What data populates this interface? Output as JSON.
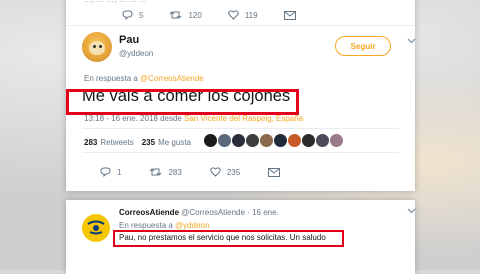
{
  "previous_tweet": {
    "faded_text": "...,  ... ..., ...  ... ...",
    "reply_count": "5",
    "retweet_count": "120",
    "like_count": "119"
  },
  "tweet": {
    "author_name": "Pau",
    "author_handle": "@yddeon",
    "follow_label": "Seguir",
    "reply_prefix": "En respuesta a",
    "reply_target": "@CorreosAtiende",
    "text": "Me vais a comer los cojones",
    "timestamp": "13:18 - 16 ene. 2018 desde",
    "location": "San Vicente del Raspeig, España",
    "retweets_number": "283",
    "retweets_label": "Retweets",
    "likes_number": "235",
    "likes_label": "Me gusta",
    "reply_count": "1",
    "retweet_count": "283",
    "like_count": "235",
    "liker_colors": [
      "#1b1b1b",
      "#5a6a7a",
      "#2a2e3a",
      "#3d3d3d",
      "#8a6a4a",
      "#1f2a3a",
      "#c85a2a",
      "#2b2b2b",
      "#4a4a5a",
      "#9a7a8a"
    ]
  },
  "reply": {
    "author_name": "CorreosAtiende",
    "author_handle": "@CorreosAtiende",
    "date": "· 16 ene.",
    "reply_prefix": "En respuesta a",
    "reply_target": "@yddeon",
    "text": "Pau, no prestamos el servicio que nos solicitas. Un saludo"
  },
  "colors": {
    "accent": "#f5a623",
    "highlight": "#e2001a",
    "correos_yellow": "#f7c600",
    "correos_blue": "#003d7c"
  }
}
